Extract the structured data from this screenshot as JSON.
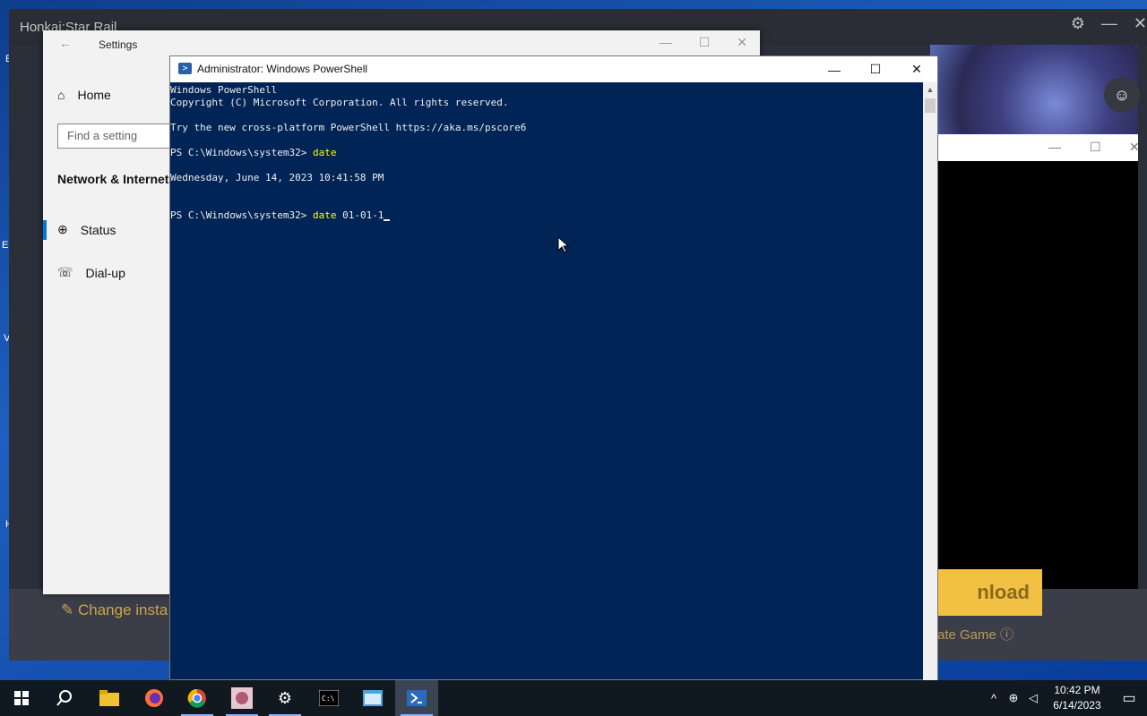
{
  "game_window": {
    "title": "Honkai:Star Rail",
    "change_install_label": "Change insta",
    "download_label": "nload",
    "locate_game_label": "ate Game"
  },
  "settings": {
    "title": "Settings",
    "home_label": "Home",
    "search_placeholder": "Find a setting",
    "section_title": "Network & Internet",
    "nav_items": [
      {
        "label": "Status",
        "icon": "globe-icon"
      },
      {
        "label": "Dial-up",
        "icon": "dialup-icon"
      }
    ]
  },
  "powershell": {
    "title": "Administrator: Windows PowerShell",
    "lines": [
      "Windows PowerShell",
      "Copyright (C) Microsoft Corporation. All rights reserved.",
      "",
      "Try the new cross-platform PowerShell https://aka.ms/pscore6",
      "",
      "PS C:\\Windows\\system32> ",
      "",
      "Wednesday, June 14, 2023 10:41:58 PM",
      "",
      "",
      "PS C:\\Windows\\system32> "
    ],
    "command1": "date",
    "command2_cmd": "date",
    "command2_args": " 01-01-1"
  },
  "taskbar": {
    "apps": [
      {
        "name": "start-button",
        "icon": "windows-icon"
      },
      {
        "name": "search-button",
        "icon": "search-icon"
      },
      {
        "name": "file-explorer",
        "icon": "folder-icon"
      },
      {
        "name": "firefox",
        "icon": "firefox-icon"
      },
      {
        "name": "chrome",
        "icon": "chrome-icon"
      },
      {
        "name": "game-launcher",
        "icon": "game-icon"
      },
      {
        "name": "settings-app",
        "icon": "gear-icon"
      },
      {
        "name": "command-prompt",
        "icon": "terminal-icon"
      },
      {
        "name": "control-panel",
        "icon": "window-icon"
      },
      {
        "name": "powershell",
        "icon": "powershell-icon"
      }
    ],
    "time": "10:42 PM",
    "date": "6/14/2023"
  }
}
